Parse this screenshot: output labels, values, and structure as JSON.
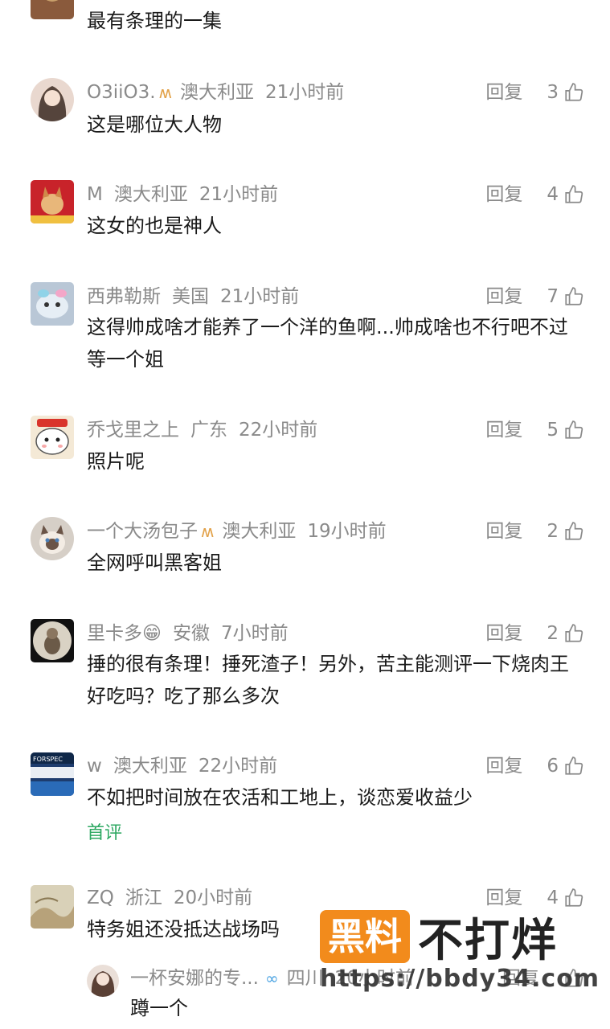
{
  "comments": [
    {
      "text": "最有条理的一集"
    },
    {
      "user": "O3iiO3.",
      "location": "澳大利亚",
      "time": "21小时前",
      "reply": "回复",
      "likes": "3",
      "text": "这是哪位大人物"
    },
    {
      "user": "M",
      "location": "澳大利亚",
      "time": "21小时前",
      "reply": "回复",
      "likes": "4",
      "text": "这女的也是神人"
    },
    {
      "user": "西弗勒斯",
      "location": "美国",
      "time": "21小时前",
      "reply": "回复",
      "likes": "7",
      "text": "这得帅成啥才能养了一个洋的鱼啊...帅成啥也不行吧不过 等一个姐"
    },
    {
      "user": "乔戈里之上",
      "location": "广东",
      "time": "22小时前",
      "reply": "回复",
      "likes": "5",
      "text": "照片呢"
    },
    {
      "user": "一个大汤包子",
      "location": "澳大利亚",
      "time": "19小时前",
      "reply": "回复",
      "likes": "2",
      "text": "全网呼叫黑客姐"
    },
    {
      "user": "里卡多😁",
      "location": "安徽",
      "time": "7小时前",
      "reply": "回复",
      "likes": "2",
      "text": "捶的很有条理！捶死渣子！另外，苦主能测评一下烧肉王好吃吗？吃了那么多次"
    },
    {
      "user": "w",
      "location": "澳大利亚",
      "time": "22小时前",
      "reply": "回复",
      "likes": "6",
      "text": "不如把时间放在农活和工地上，谈恋爱收益少",
      "tag": "首评"
    },
    {
      "user": "ZQ",
      "location": "浙江",
      "time": "20小时前",
      "reply": "回复",
      "likes": "4",
      "text": "特务姐还没抵达战场吗"
    },
    {
      "user": "一杯安娜的专...",
      "location": "四川",
      "time": "20小时前",
      "reply": "回复",
      "likes": "",
      "text": "蹲一个"
    }
  ],
  "watermark": {
    "brand": "黑料",
    "slogan": "不打烊",
    "url": "https://bbdy34.com"
  },
  "colors": {
    "meta": "#8a8a8a",
    "tag": "#2da862",
    "badge": "#e2a24a",
    "watermark": "#f28b1c"
  }
}
